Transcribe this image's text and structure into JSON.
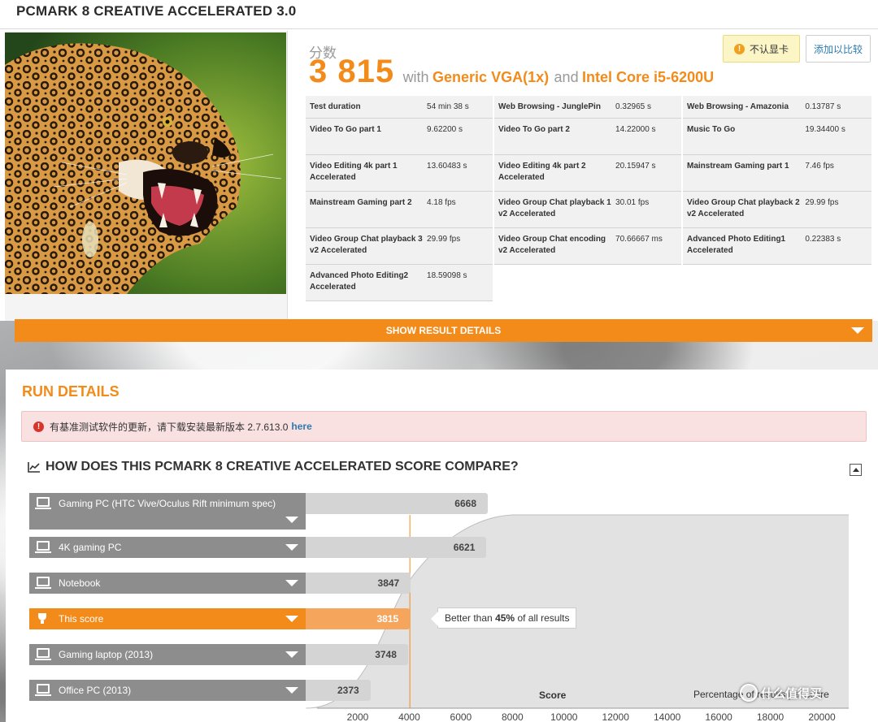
{
  "header": {
    "title": "PCMARK 8 CREATIVE ACCELERATED 3.0"
  },
  "score": {
    "label": "分数",
    "value": "3 815",
    "with_text": "with",
    "gpu": "Generic VGA(1x)",
    "and_text": "and",
    "cpu": "Intel Core i5-6200U"
  },
  "actions": {
    "no_gpu_label": "不认显卡",
    "no_gpu_icon": "!",
    "compare_label": "添加以比较"
  },
  "results": [
    {
      "name": "Test duration",
      "value": "54 min 38 s"
    },
    {
      "name": "Web Browsing - JunglePin",
      "value": "0.32965 s"
    },
    {
      "name": "Web Browsing - Amazonia",
      "value": "0.13787 s"
    },
    {
      "name": "Video To Go part 1",
      "value": "9.62200 s"
    },
    {
      "name": "Video To Go part 2",
      "value": "14.22000 s"
    },
    {
      "name": "Music To Go",
      "value": "19.34400 s"
    },
    {
      "name": "Video Editing 4k part 1 Accelerated",
      "value": "13.60483 s"
    },
    {
      "name": "Video Editing 4k part 2 Accelerated",
      "value": "20.15947 s"
    },
    {
      "name": "Mainstream Gaming part 1",
      "value": "7.46 fps"
    },
    {
      "name": "Mainstream Gaming part 2",
      "value": "4.18 fps"
    },
    {
      "name": "Video Group Chat playback 1 v2 Accelerated",
      "value": "30.01 fps"
    },
    {
      "name": "Video Group Chat playback 2 v2 Accelerated",
      "value": "29.99 fps"
    },
    {
      "name": "Video Group Chat playback 3 v2 Accelerated",
      "value": "29.99 fps"
    },
    {
      "name": "Video Group Chat encoding v2 Accelerated",
      "value": "70.66667 ms"
    },
    {
      "name": "Advanced Photo Editing1 Accelerated",
      "value": "0.22383 s"
    },
    {
      "name": "Advanced Photo Editing2 Accelerated",
      "value": "18.59098 s"
    }
  ],
  "show_details": {
    "label": "SHOW RESULT DETAILS"
  },
  "run_details": {
    "title": "RUN DETAILS",
    "alert_icon": "!",
    "alert_text": "有基准测试软件的更新，请下载安装最新版本 2.7.613.0",
    "alert_link": "here"
  },
  "compare": {
    "title": "HOW DOES THIS PCMARK 8 CREATIVE ACCELERATED SCORE COMPARE?",
    "callout_prefix": "Better than",
    "callout_percent": "45%",
    "callout_suffix": "of all results",
    "axis_title": "Score",
    "pct_title": "Percentage of results per score",
    "watermark": "什么值得买",
    "colors": {
      "accent": "#f38b1a",
      "this_bar": "#f6a65c",
      "bar": "#d4d4d4",
      "label_bg": "#8d8d8d"
    }
  },
  "chart_data": {
    "type": "bar",
    "categories": [
      "Gaming PC (HTC Vive/Oculus Rift minimum spec)",
      "4K gaming PC",
      "Notebook",
      "This score",
      "Gaming laptop (2013)",
      "Office PC (2013)"
    ],
    "values": [
      6668,
      6621,
      3847,
      3815,
      3748,
      2373
    ],
    "highlight": "This score",
    "xlabel": "Score",
    "x_ticks": [
      2000,
      4000,
      6000,
      8000,
      10000,
      12000,
      14000,
      16000,
      18000,
      20000
    ],
    "percentile": 45
  }
}
